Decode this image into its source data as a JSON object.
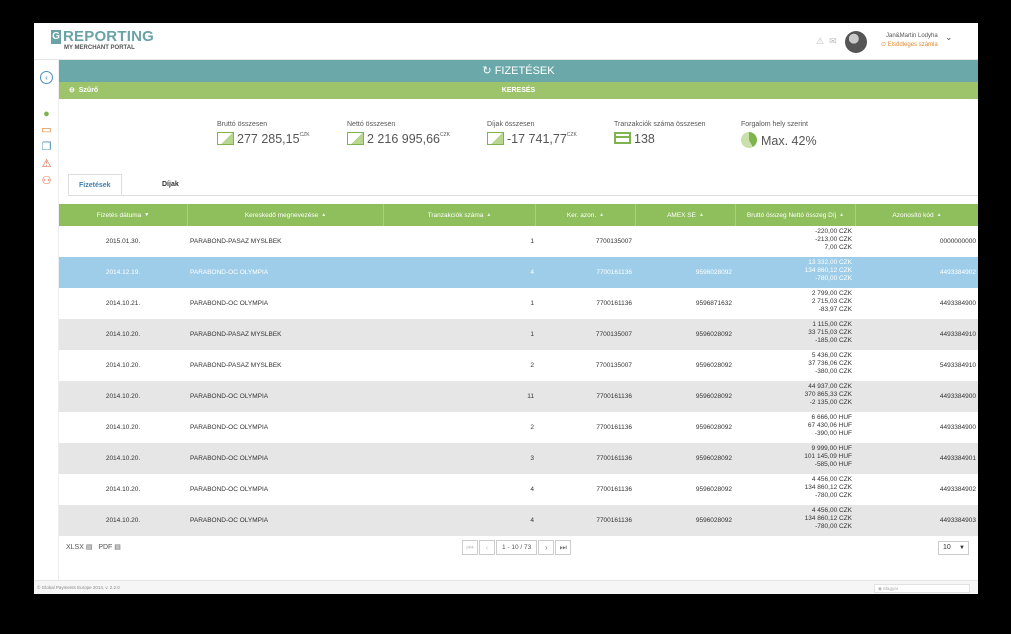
{
  "app": {
    "logo_mark": "G",
    "logo_text": "REPORTING",
    "logo_sub": "MY MERCHANT PORTAL"
  },
  "user": {
    "name": "Jan&Martin Lodyha",
    "account": "Elsődleges számla"
  },
  "page": {
    "title": "FIZETÉSEK",
    "filter_label": "Szűrő",
    "search_label": "KERESÉS"
  },
  "stats": [
    {
      "label": "Bruttó összesen",
      "value": "277 285,15",
      "unit": "CZK"
    },
    {
      "label": "Nettó összesen",
      "value": "2 216 995,66",
      "unit": "CZK"
    },
    {
      "label": "Díjak összesen",
      "value": "-17 741,77",
      "unit": "CZK"
    },
    {
      "label": "Tranzakciók száma összesen",
      "value": "138"
    },
    {
      "label": "Forgalom hely szerint",
      "value": "Max. 42%"
    }
  ],
  "tabs": [
    {
      "label": "Fizetések"
    },
    {
      "label": "Díjak"
    }
  ],
  "table": {
    "headers": [
      "Fizetés dátuma",
      "Kereskedő megnevezése",
      "Tranzakciók száma",
      "Ker. azon.",
      "AMEX SE",
      "Bruttó összeg Nettó összeg Díj",
      "Azonosító kód"
    ],
    "rows": [
      {
        "date": "2015.01.30.",
        "name": "PARABOND-PASAZ MYSLBEK",
        "count": "1",
        "ker": "7700135007",
        "amex": "",
        "gross": "-220,00 CZK",
        "net": "-213,00 CZK",
        "fee": "7,00 CZK",
        "code": "0000000000"
      },
      {
        "date": "2014.12.19.",
        "name": "PARABOND-OC OLYMPIA",
        "count": "4",
        "ker": "7700161136",
        "amex": "9596028092",
        "gross": "13 332,00 CZK",
        "net": "134 860,12 CZK",
        "fee": "-780,00 CZK",
        "code": "4493384902"
      },
      {
        "date": "2014.10.21.",
        "name": "PARABOND-OC OLYMPIA",
        "count": "1",
        "ker": "7700161136",
        "amex": "9596871632",
        "gross": "2 799,00 CZK",
        "net": "2 715,03 CZK",
        "fee": "-83,97 CZK",
        "code": "4493384900"
      },
      {
        "date": "2014.10.20.",
        "name": "PARABOND-PASAZ MYSLBEK",
        "count": "1",
        "ker": "7700135007",
        "amex": "9596028092",
        "gross": "1 115,00 CZK",
        "net": "33 715,03 CZK",
        "fee": "-185,00 CZK",
        "code": "4493384910"
      },
      {
        "date": "2014.10.20.",
        "name": "PARABOND-PASAZ MYSLBEK",
        "count": "2",
        "ker": "7700135007",
        "amex": "9596028092",
        "gross": "5 436,00 CZK",
        "net": "37 736,06 CZK",
        "fee": "-380,00 CZK",
        "code": "5493384910"
      },
      {
        "date": "2014.10.20.",
        "name": "PARABOND-OC OLYMPIA",
        "count": "11",
        "ker": "7700161136",
        "amex": "9596028092",
        "gross": "44 937,00 CZK",
        "net": "370 865,33 CZK",
        "fee": "-2 135,00 CZK",
        "code": "4493384900"
      },
      {
        "date": "2014.10.20.",
        "name": "PARABOND-OC OLYMPIA",
        "count": "2",
        "ker": "7700161136",
        "amex": "9596028092",
        "gross": "6 666,00 HUF",
        "net": "67 430,06 HUF",
        "fee": "-390,00 HUF",
        "code": "4493384900"
      },
      {
        "date": "2014.10.20.",
        "name": "PARABOND-OC OLYMPIA",
        "count": "3",
        "ker": "7700161136",
        "amex": "9596028092",
        "gross": "9 999,00 HUF",
        "net": "101 145,09 HUF",
        "fee": "-585,00 HUF",
        "code": "4493384901"
      },
      {
        "date": "2014.10.20.",
        "name": "PARABOND-OC OLYMPIA",
        "count": "4",
        "ker": "7700161136",
        "amex": "9596028092",
        "gross": "4 456,00 CZK",
        "net": "134 860,12 CZK",
        "fee": "-780,00 CZK",
        "code": "4493384902"
      },
      {
        "date": "2014.10.20.",
        "name": "PARABOND-OC OLYMPIA",
        "count": "4",
        "ker": "7700161136",
        "amex": "9596028092",
        "gross": "4 456,00 CZK",
        "net": "134 860,12 CZK",
        "fee": "-780,00 CZK",
        "code": "4493384903"
      }
    ],
    "selected_row": 1
  },
  "footer": {
    "export_xlsx": "XLSX",
    "export_pdf": "PDF",
    "pager_info": "1 - 10 / 73",
    "page_size": "10",
    "copyright": "© Global Payments Europe 2014, v. 2.2.0",
    "language": "Magyar"
  },
  "colors": {
    "accent_teal": "#6aa8aa",
    "accent_green": "#8ebf5c",
    "selected_row": "#9dcde8"
  }
}
